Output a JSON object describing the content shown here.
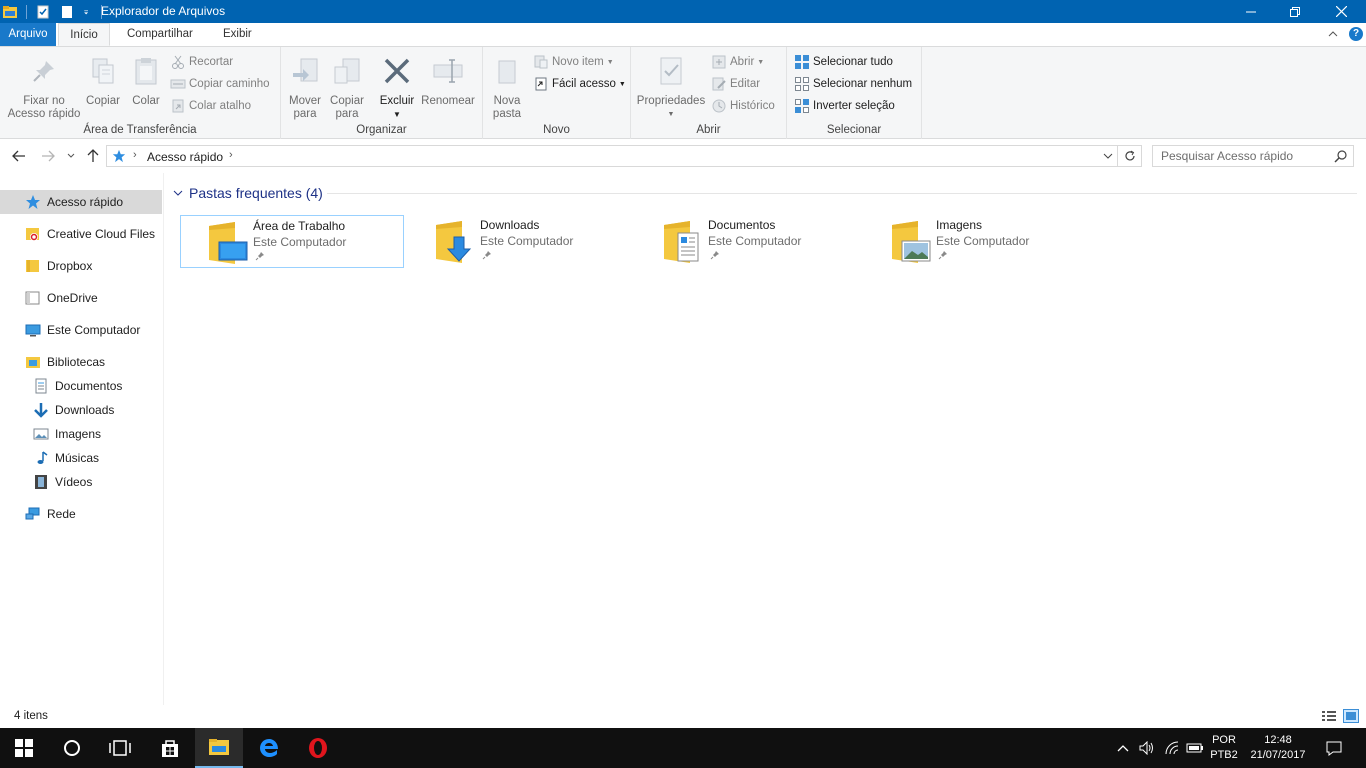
{
  "window": {
    "title": "Explorador de Arquivos"
  },
  "tabs": {
    "file": "Arquivo",
    "home": "Início",
    "share": "Compartilhar",
    "view": "Exibir"
  },
  "ribbon": {
    "clipboard": {
      "label": "Área de Transferência",
      "pin": [
        "Fixar no",
        "Acesso rápido"
      ],
      "copy": "Copiar",
      "paste": "Colar",
      "cut": "Recortar",
      "copy_path": "Copiar caminho",
      "paste_shortcut": "Colar atalho"
    },
    "organize": {
      "label": "Organizar",
      "move_to": [
        "Mover",
        "para"
      ],
      "copy_to": [
        "Copiar",
        "para"
      ],
      "delete": "Excluir",
      "rename": "Renomear"
    },
    "new": {
      "label": "Novo",
      "new_folder": [
        "Nova",
        "pasta"
      ],
      "new_item": "Novo item",
      "easy_access": "Fácil acesso"
    },
    "open": {
      "label": "Abrir",
      "properties": "Propriedades",
      "open": "Abrir",
      "edit": "Editar",
      "history": "Histórico"
    },
    "select": {
      "label": "Selecionar",
      "select_all": "Selecionar tudo",
      "select_none": "Selecionar nenhum",
      "invert": "Inverter seleção"
    }
  },
  "address": {
    "crumb": "Acesso rápido",
    "search_placeholder": "Pesquisar Acesso rápido"
  },
  "nav": {
    "quick_access": "Acesso rápido",
    "creative_cloud": "Creative Cloud Files",
    "dropbox": "Dropbox",
    "onedrive": "OneDrive",
    "this_pc": "Este Computador",
    "libraries": "Bibliotecas",
    "documents": "Documentos",
    "downloads": "Downloads",
    "images": "Imagens",
    "music": "Músicas",
    "videos": "Vídeos",
    "network": "Rede"
  },
  "content": {
    "group_title": "Pastas frequentes (4)",
    "folders": [
      {
        "name": "Área de Trabalho",
        "location": "Este Computador",
        "icon": "desktop-folder-icon"
      },
      {
        "name": "Downloads",
        "location": "Este Computador",
        "icon": "downloads-folder-icon"
      },
      {
        "name": "Documentos",
        "location": "Este Computador",
        "icon": "documents-folder-icon"
      },
      {
        "name": "Imagens",
        "location": "Este Computador",
        "icon": "pictures-folder-icon"
      }
    ]
  },
  "status": {
    "count": "4 itens"
  },
  "taskbar": {
    "language": "POR",
    "layout": "PTB2",
    "time": "12:48",
    "date": "21/07/2017"
  },
  "colors": {
    "titlebar": "#0063b1",
    "file_tab": "#1979ca",
    "ribbon_bg": "#f5f6f7",
    "selection": "#d9d9d9",
    "group_header": "#1e3287",
    "taskbar": "#101010"
  }
}
